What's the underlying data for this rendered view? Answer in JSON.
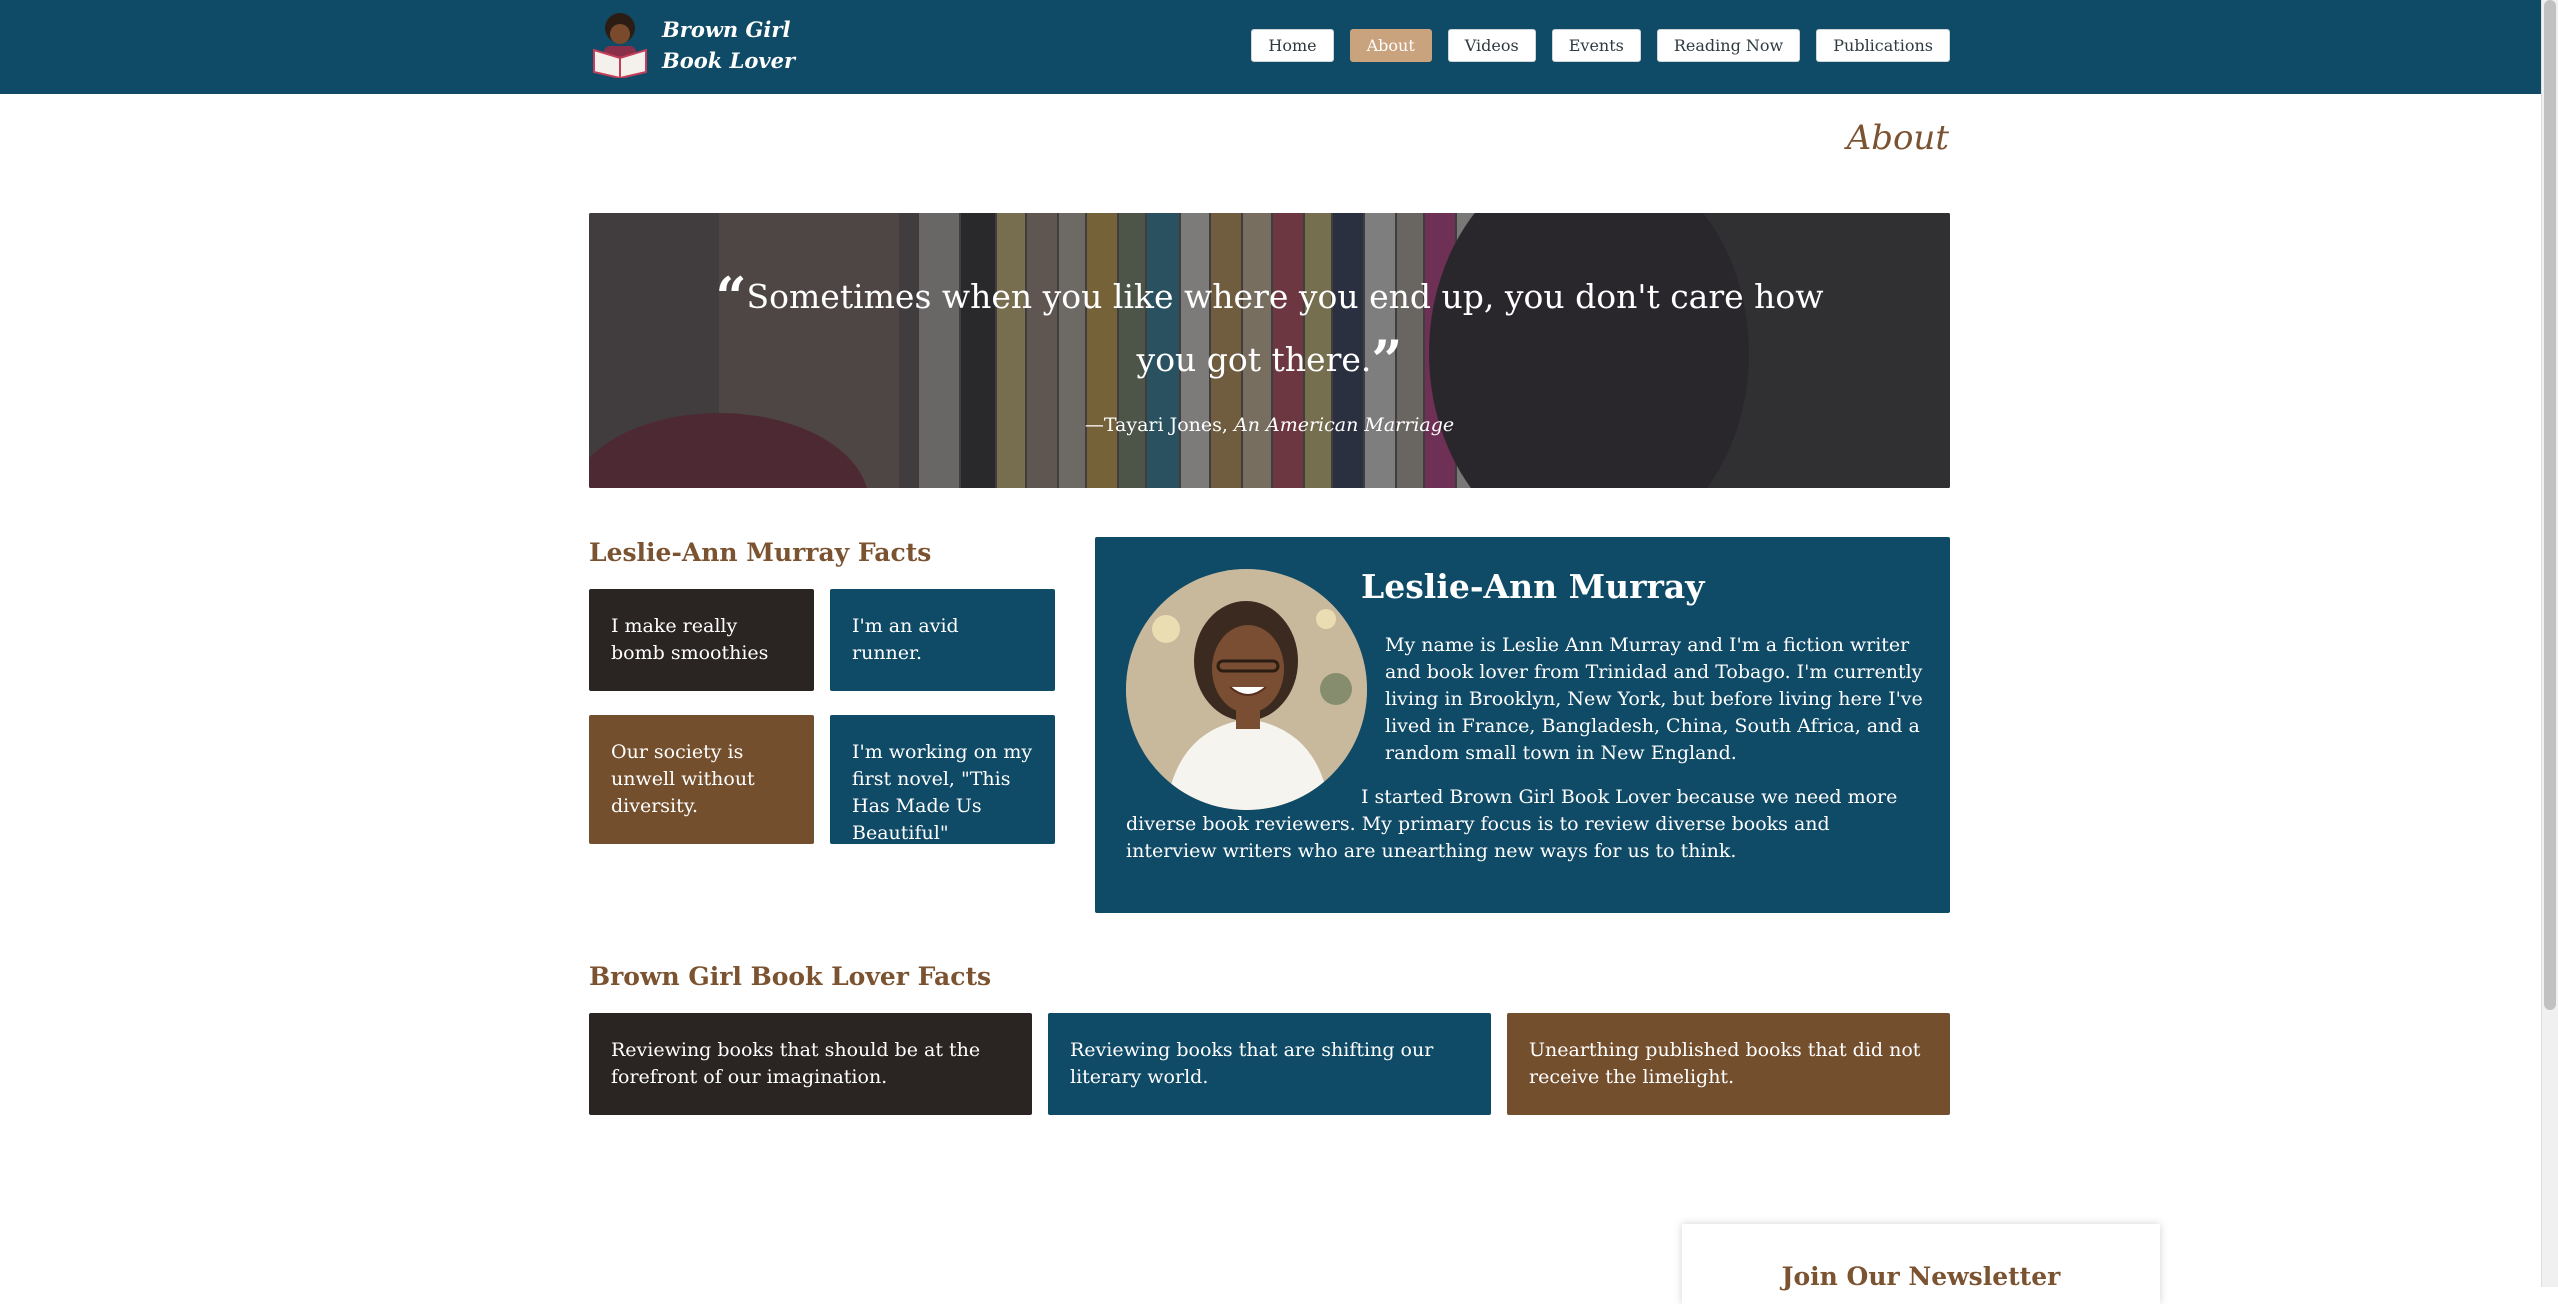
{
  "site": {
    "logo_line1": "Brown Girl",
    "logo_line2": "Book Lover"
  },
  "nav": {
    "items": [
      "Home",
      "About",
      "Videos",
      "Events",
      "Reading Now",
      "Publications"
    ],
    "active": "About"
  },
  "page_title": "About",
  "hero": {
    "quote": "Sometimes when you like where you end up, you don't care how you got there.",
    "attribution_author": "—Tayari Jones,",
    "attribution_work": "An American Marriage"
  },
  "murray_facts": {
    "title": "Leslie-Ann Murray Facts",
    "cards": [
      "I make really bomb smoothies",
      "I'm an avid runner.",
      "Our society is unwell without diversity.",
      "I'm working on my first novel, \"This Has Made Us Beautiful\""
    ]
  },
  "profile": {
    "name": "Leslie-Ann Murray",
    "para1": "My name is Leslie Ann Murray and I'm a fiction writer and book lover from Trinidad and Tobago. I'm currently living in Brooklyn, New York, but before living here I've lived in France, Bangladesh, China, South Africa, and a random small town in New England.",
    "para2": "I started Brown Girl Book Lover because we need more diverse book reviewers. My primary focus is to review diverse books and interview writers who are unearthing new ways for us to think."
  },
  "bgbl_facts": {
    "title": "Brown Girl Book Lover Facts",
    "cards": [
      "Reviewing books that should be at the forefront of our imagination.",
      "Reviewing books that are shifting our literary world.",
      "Unearthing published books that did not receive the limelight."
    ]
  },
  "newsletter": {
    "title": "Join Our Newsletter"
  },
  "colors": {
    "header": "#0f4a66",
    "accent_brown": "#744f2d",
    "dark": "#2a2523",
    "active_nav": "#c9a27e"
  }
}
